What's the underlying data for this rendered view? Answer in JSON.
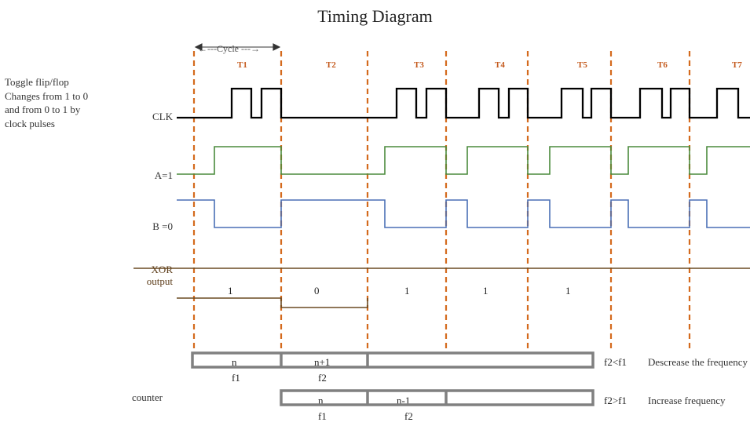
{
  "title": "Timing Diagram",
  "note": {
    "l1": "Toggle flip/flop",
    "l2": "Changes from  1  to 0",
    "l3": "and from 0 to 1 by",
    "l4": "clock pulses"
  },
  "cycleLabel": "←---Cycle ---→",
  "tLabels": {
    "t1": "T1",
    "t2": "T2",
    "t3": "T3",
    "t4": "T4",
    "t5": "T5",
    "t6": "T6",
    "t7": "T7"
  },
  "signals": {
    "clk": "CLK",
    "a": "A=1",
    "b": "B =0",
    "xor1": "XOR",
    "xor2": "output"
  },
  "xorVals": {
    "v1": "1",
    "v2": "0",
    "v3": "1",
    "v4": "1",
    "v5": "1"
  },
  "counterLabel": "counter",
  "rowA": {
    "c1": "n",
    "c2": "n+1",
    "f1": "f1",
    "f2": "f2",
    "cond": "f2<f1",
    "desc": "Descrease the frequency"
  },
  "rowB": {
    "c1": "n",
    "c2": "n-1",
    "f1": "f1",
    "f2": "f2",
    "cond": "f2>f1",
    "desc": "Increase frequency"
  }
}
